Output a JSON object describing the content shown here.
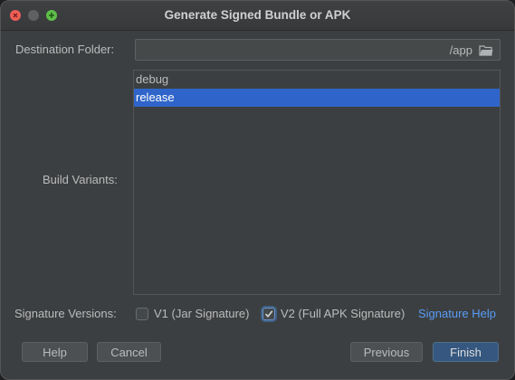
{
  "window": {
    "title": "Generate Signed Bundle or APK"
  },
  "destination": {
    "label": "Destination Folder:",
    "value": "/app",
    "icon": "folder-icon"
  },
  "build_variants": {
    "label": "Build Variants:",
    "items": [
      "debug",
      "release"
    ],
    "selected": "release"
  },
  "signature": {
    "label": "Signature Versions:",
    "v1": {
      "label": "V1 (Jar Signature)",
      "checked": false
    },
    "v2": {
      "label": "V2 (Full APK Signature)",
      "checked": true
    },
    "help_link": "Signature Help"
  },
  "buttons": {
    "help": "Help",
    "cancel": "Cancel",
    "previous": "Previous",
    "finish": "Finish"
  },
  "colors": {
    "selection": "#2f65ca",
    "link": "#589df6",
    "primary_button": "#365880",
    "close": "#ee5f57",
    "zoom": "#5ebf4a"
  }
}
